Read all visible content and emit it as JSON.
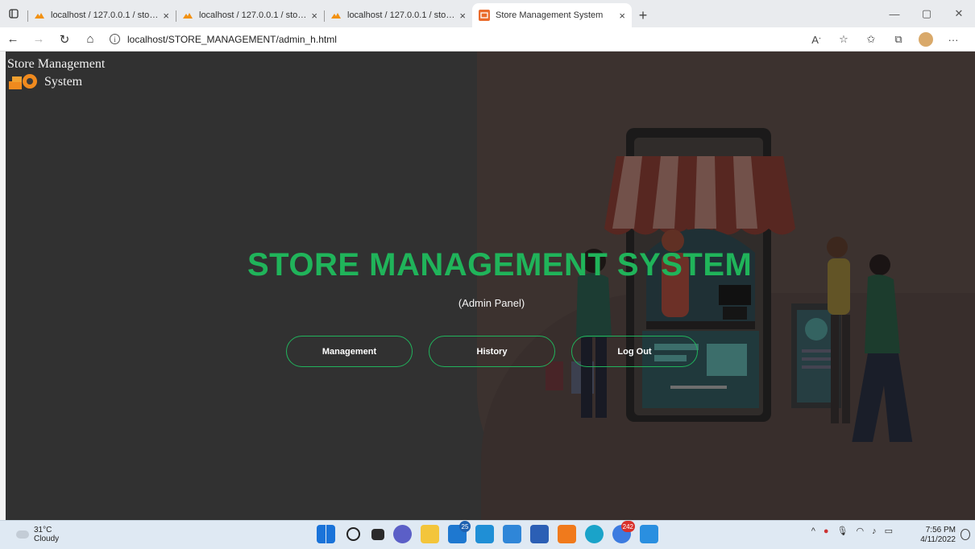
{
  "browser": {
    "tabs": [
      {
        "title": "localhost / 127.0.0.1 / store_man",
        "close": "×"
      },
      {
        "title": "localhost / 127.0.0.1 / store_man",
        "close": "×"
      },
      {
        "title": "localhost / 127.0.0.1 / store_man",
        "close": "×"
      },
      {
        "title": "Store Management System",
        "close": "×",
        "active": true
      }
    ],
    "new_tab": "+",
    "window_controls": {
      "minimize": "—",
      "maximize": "▢",
      "close": "✕"
    },
    "address": "localhost/STORE_MANAGEMENT/admin_h.html",
    "info_icon": "i",
    "toolbar_icons": [
      "read-aloud-icon",
      "favorite-add-icon",
      "favorites-icon",
      "collections-icon",
      "profile-avatar",
      "more-icon"
    ],
    "more": "···"
  },
  "brand": {
    "line1": "Store Management",
    "line2": "System",
    "logo_icon": "store-logo-icon"
  },
  "hero": {
    "title": "STORE MANAGEMENT SYSTEM",
    "subtitle": "(Admin Panel)"
  },
  "buttons": {
    "management": "Management",
    "history": "History",
    "logout": "Log Out"
  },
  "colors": {
    "accent": "#20b45a",
    "page_bg": "#3b3b3b",
    "button_border": "#21b35c"
  },
  "taskbar": {
    "weather_temp": "31°C",
    "weather_desc": "Cloudy",
    "badges": {
      "mail": "25",
      "chrome": "242"
    },
    "time": "7:56 PM",
    "date": "4/11/2022"
  }
}
